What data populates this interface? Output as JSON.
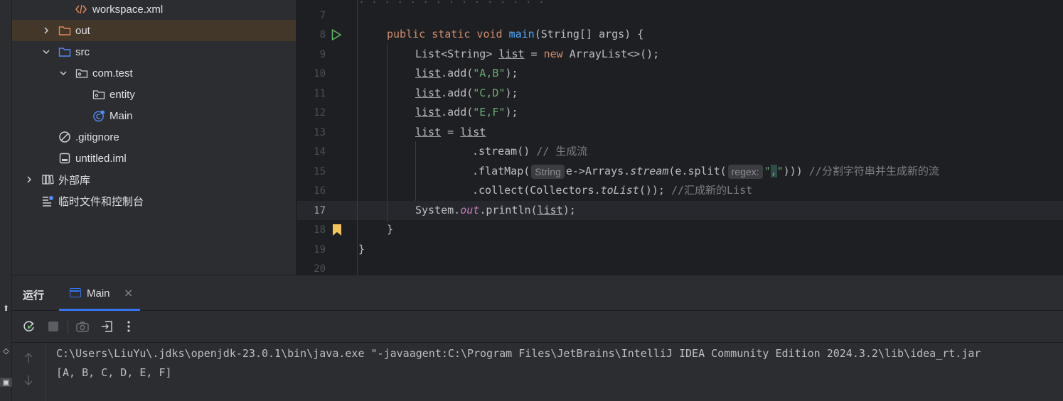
{
  "project_tree": {
    "items": [
      {
        "label": "workspace.xml",
        "icon": "xml-file-icon"
      },
      {
        "label": "out",
        "icon": "folder-icon",
        "expanded": false
      },
      {
        "label": "src",
        "icon": "source-folder-icon",
        "expanded": true
      },
      {
        "label": "com.test",
        "icon": "package-icon",
        "expanded": true
      },
      {
        "label": "entity",
        "icon": "package-icon"
      },
      {
        "label": "Main",
        "icon": "java-class-run-icon"
      },
      {
        "label": ".gitignore",
        "icon": "ignore-file-icon"
      },
      {
        "label": "untitled.iml",
        "icon": "module-file-icon"
      },
      {
        "label": "外部库",
        "icon": "library-icon",
        "expanded": false
      },
      {
        "label": "临时文件和控制台",
        "icon": "scratches-icon"
      }
    ]
  },
  "editor": {
    "line_numbers": [
      "7",
      "8",
      "9",
      "10",
      "11",
      "12",
      "13",
      "14",
      "15",
      "16",
      "17",
      "18",
      "19",
      "20"
    ],
    "active_line": "17",
    "code": {
      "l8_kw": "public static void ",
      "l8_fn": "main",
      "l8_rest": "(String[] args) {",
      "l9_a": "List<String> ",
      "l9_var": "list",
      "l9_b": " = ",
      "l9_kw": "new",
      "l9_c": " ArrayList<>();",
      "l10_var": "list",
      "l10_a": ".add(",
      "l10_str": "\"A,B\"",
      "l10_b": ");",
      "l11_var": "list",
      "l11_a": ".add(",
      "l11_str": "\"C,D\"",
      "l11_b": ");",
      "l12_var": "list",
      "l12_a": ".add(",
      "l12_str": "\"E,F\"",
      "l12_b": ");",
      "l13_var": "list",
      "l13_a": " = ",
      "l13_var2": "list",
      "l14_a": ".stream() ",
      "l14_cmt": "// 生成流",
      "l15_a": ".flatMap(",
      "l15_hint1": "String",
      "l15_b": "e->Arrays.",
      "l15_it": "stream",
      "l15_c": "(e.split(",
      "l15_hint2": "regex:",
      "l15_str1": "\"",
      "l15_str2": ",",
      "l15_str3": "\"",
      "l15_d": "))) ",
      "l15_cmt": "//分割字符串并生成新的流",
      "l16_a": ".collect(Collectors.",
      "l16_it": "toList",
      "l16_b": "()); ",
      "l16_cmt": "//汇成新的List",
      "l17_a": "System.",
      "l17_fld": "out",
      "l17_b": ".println(",
      "l17_var": "list",
      "l17_c": ");",
      "l18": "}",
      "l19": "}"
    }
  },
  "run_panel": {
    "title": "运行",
    "tab_label": "Main",
    "toolbar": [
      "rerun-icon",
      "stop-icon",
      "camera-icon",
      "exit-icon",
      "more-icon"
    ],
    "console_lines": [
      "C:\\Users\\LiuYu\\.jdks\\openjdk-23.0.1\\bin\\java.exe \"-javaagent:C:\\Program Files\\JetBrains\\IntelliJ IDEA Community Edition 2024.3.2\\lib\\idea_rt.jar",
      "[A, B, C, D, E, F]"
    ]
  },
  "colors": {
    "accent": "#3574f0",
    "run_green": "#5fb865",
    "bookmark": "#f2c55c",
    "selection": "#43372a"
  }
}
